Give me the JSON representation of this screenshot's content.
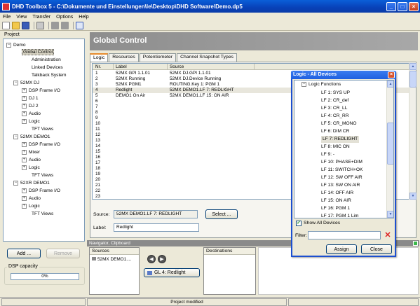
{
  "window": {
    "title": "DHD Toolbox 5 - C:\\Dokumente und Einstellungen\\le\\Desktop\\DHD Software\\Demo.dp5"
  },
  "menu": [
    "File",
    "View",
    "Transfer",
    "Options",
    "Help"
  ],
  "project": {
    "label": "Project",
    "tree": [
      "Demo",
      "Global Control",
      "Administration",
      "Linked Devices",
      "Talkback System",
      "52MX DJ",
      "DSP Frame I/O",
      "DJ 1",
      "DJ 2",
      "Audio",
      "Logic",
      "TFT Views",
      "52MX DEMO1",
      "DSP Frame I/O",
      "Mixer",
      "Audio",
      "Logic",
      "TFT Views",
      "52XR DEMO1",
      "DSP Frame I/O",
      "Audio",
      "Logic",
      "TFT Views"
    ],
    "add_label": "Add ...",
    "remove_label": "Remove",
    "dsp_label": "DSP capacity",
    "dsp_value": "0%",
    "dsp_fraction": 0
  },
  "main": {
    "header": "Global Control",
    "tabs": [
      "Logic",
      "Resources",
      "Potentiometer",
      "Channel Snapshot Types"
    ],
    "columns": [
      "Nr.",
      "Label",
      "Source"
    ],
    "rows": [
      [
        "1",
        "52MX GPI 1.1.01",
        "52MX DJ.GPI 1.1.01"
      ],
      [
        "2",
        "52MX Running",
        "52MX DJ.Device Running"
      ],
      [
        "3",
        "52MX PGM1",
        "ROUTING.Key 1: PGM 1"
      ],
      [
        "4",
        "Redlight",
        "52MX DEMO1.LF 7: REDLIGHT"
      ],
      [
        "5",
        "DEMO1 On Air",
        "52MX DEMO1.LF 15: ON AIR"
      ],
      [
        "6",
        "",
        ""
      ],
      [
        "7",
        "",
        ""
      ],
      [
        "8",
        "",
        ""
      ],
      [
        "9",
        "",
        ""
      ],
      [
        "10",
        "",
        ""
      ],
      [
        "11",
        "",
        ""
      ],
      [
        "12",
        "",
        ""
      ],
      [
        "13",
        "",
        ""
      ],
      [
        "14",
        "",
        ""
      ],
      [
        "15",
        "",
        ""
      ],
      [
        "16",
        "",
        ""
      ],
      [
        "17",
        "",
        ""
      ],
      [
        "18",
        "",
        ""
      ],
      [
        "19",
        "",
        ""
      ],
      [
        "20",
        "",
        ""
      ],
      [
        "21",
        "",
        ""
      ],
      [
        "22",
        "",
        ""
      ],
      [
        "23",
        "",
        ""
      ]
    ],
    "source_label": "Source:",
    "source_value": "52MX DEMO1.LF 7: REDLIGHT",
    "select_label": "Select ...",
    "label_label": "Label:",
    "label_value": "Redlight"
  },
  "navigator": {
    "title": "Navigator, Clipboard",
    "sources_header": "Sources",
    "source_item": "52MX DEMO1....",
    "gl_button": "GL 4: Redlight",
    "destinations_header": "Destinations"
  },
  "status": {
    "text": "Project modified"
  },
  "dialog": {
    "title": "Logic - All Devices",
    "group": "Logic Functions",
    "items": [
      "LF 1: SYS UP",
      "LF 2: CR_def",
      "LF 3: CR_LL",
      "LF 4: CR_RR",
      "LF 5: CR_MONO",
      "LF 6: DIM CR",
      "LF 7: REDLIGHT",
      "LF 8: MIC ON",
      "LF 9: -",
      "LF 10: PHASE+DIM",
      "LF 11: SWITCH+OK",
      "LF 12: SW OFF AIR",
      "LF 13: SW ON AIR",
      "LF 14: OFF AIR",
      "LF 15: ON AIR",
      "LF 16: PGM 1",
      "LF 17: PGM 1 Lim"
    ],
    "selected_index": 6,
    "show_all_label": "Show All Devices",
    "filter_label": "Filter:",
    "filter_value": "",
    "assign_label": "Assign",
    "close_label": "Close"
  }
}
